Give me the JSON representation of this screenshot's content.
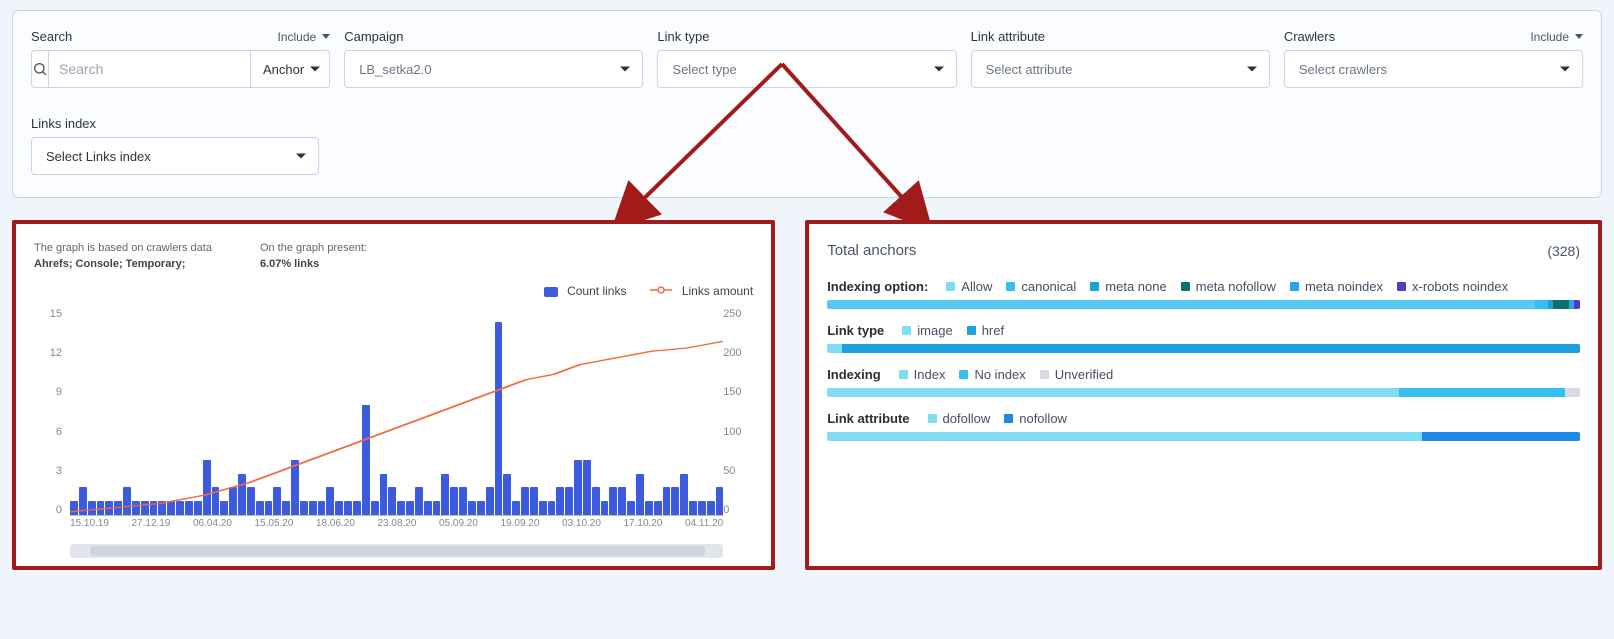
{
  "filters": {
    "search": {
      "label": "Search",
      "include": "Include",
      "placeholder": "Search",
      "anchor_label": "Anchor"
    },
    "campaign": {
      "label": "Campaign",
      "value": "LB_setka2.0"
    },
    "link_type": {
      "label": "Link type",
      "placeholder": "Select type"
    },
    "link_attribute": {
      "label": "Link attribute",
      "placeholder": "Select attribute"
    },
    "crawlers": {
      "label": "Crawlers",
      "include": "Include",
      "placeholder": "Select crawlers"
    },
    "links_index": {
      "label": "Links index",
      "placeholder": "Select Links index"
    }
  },
  "chart_panel": {
    "caption1_title": "The graph is based on crawlers data",
    "caption1_body": "Ahrefs; Console; Temporary;",
    "caption2_title": "On the graph present:",
    "caption2_body": "6.07% links",
    "legend_count": "Count links",
    "legend_amount": "Links amount"
  },
  "chart_data": {
    "type": "bar",
    "ylabel_left": "Count links",
    "ylabel_right": "Links amount",
    "yticks_left": [
      15,
      12,
      9,
      6,
      3,
      0
    ],
    "yticks_right": [
      250,
      200,
      150,
      100,
      50,
      0
    ],
    "ylim_left": [
      0,
      15
    ],
    "ylim_right": [
      0,
      250
    ],
    "x_labels": [
      "15.10.19",
      "27.12.19",
      "06.04.20",
      "15.05.20",
      "18.06.20",
      "23.08.20",
      "05.09.20",
      "19.09.20",
      "03.10.20",
      "17.10.20",
      "04.11.20"
    ],
    "series": [
      {
        "name": "Count links",
        "type": "bar",
        "color": "#3d5bdf",
        "values": [
          1,
          2,
          1,
          1,
          1,
          1,
          2,
          1,
          1,
          1,
          1,
          1,
          1,
          1,
          1,
          4,
          2,
          1,
          2,
          3,
          2,
          1,
          1,
          2,
          1,
          4,
          1,
          1,
          1,
          2,
          1,
          1,
          1,
          8,
          1,
          3,
          2,
          1,
          1,
          2,
          1,
          1,
          3,
          2,
          2,
          1,
          1,
          2,
          14,
          3,
          1,
          2,
          2,
          1,
          1,
          2,
          2,
          4,
          4,
          2,
          1,
          2,
          2,
          1,
          3,
          1,
          1,
          2,
          2,
          3,
          1,
          1,
          1,
          2
        ]
      },
      {
        "name": "Links amount",
        "type": "line",
        "color": "#f26a3f",
        "values": [
          5,
          6,
          7,
          8,
          9,
          10,
          11,
          12,
          13,
          14,
          15,
          17,
          19,
          21,
          23,
          25,
          28,
          31,
          34,
          37,
          40,
          44,
          48,
          52,
          56,
          60,
          64,
          68,
          72,
          76,
          80,
          84,
          88,
          92,
          96,
          100,
          104,
          108,
          112,
          116,
          120,
          124,
          128,
          132,
          136,
          140,
          144,
          148,
          152,
          156,
          160,
          164,
          166,
          168,
          170,
          174,
          178,
          182,
          184,
          186,
          188,
          190,
          192,
          194,
          196,
          198,
          199,
          200,
          201,
          202,
          204,
          206,
          208,
          210
        ]
      }
    ]
  },
  "anchors": {
    "title": "Total anchors",
    "count": "(328)",
    "rows": [
      {
        "name": "Indexing option:",
        "items": [
          {
            "label": "Allow",
            "color": "#7fdcf1"
          },
          {
            "label": "canonical",
            "color": "#35bff0"
          },
          {
            "label": "meta none",
            "color": "#1e9fe0"
          },
          {
            "label": "meta nofollow",
            "color": "#0f6f6e"
          },
          {
            "label": "meta noindex",
            "color": "#2aa6e8"
          },
          {
            "label": "x-robots noindex",
            "color": "#4c3cc7"
          }
        ],
        "segments": [
          {
            "color": "#57c9f2",
            "pct": 94
          },
          {
            "color": "#35bff0",
            "pct": 1.8
          },
          {
            "color": "#1e9fe0",
            "pct": 0.6
          },
          {
            "color": "#0f6f6e",
            "pct": 2.2
          },
          {
            "color": "#2aa6e8",
            "pct": 0.6
          },
          {
            "color": "#4c3cc7",
            "pct": 0.8
          }
        ]
      },
      {
        "name": "Link type",
        "items": [
          {
            "label": "image",
            "color": "#7fdcf1"
          },
          {
            "label": "href",
            "color": "#1e9fe0"
          }
        ],
        "segments": [
          {
            "color": "#7fdcf1",
            "pct": 2
          },
          {
            "color": "#1e9fe0",
            "pct": 98
          }
        ]
      },
      {
        "name": "Indexing",
        "items": [
          {
            "label": "Index",
            "color": "#7fdcf1"
          },
          {
            "label": "No index",
            "color": "#35bff0"
          },
          {
            "label": "Unverified",
            "color": "#d6dbe2"
          }
        ],
        "segments": [
          {
            "color": "#7fdcf1",
            "pct": 76
          },
          {
            "color": "#35bff0",
            "pct": 22
          },
          {
            "color": "#d6dbe2",
            "pct": 2
          }
        ]
      },
      {
        "name": "Link attribute",
        "items": [
          {
            "label": "dofollow",
            "color": "#7fdcf1"
          },
          {
            "label": "nofollow",
            "color": "#1e88e5"
          }
        ],
        "segments": [
          {
            "color": "#7fdcf1",
            "pct": 79
          },
          {
            "color": "#1e88e5",
            "pct": 21
          }
        ]
      }
    ]
  }
}
